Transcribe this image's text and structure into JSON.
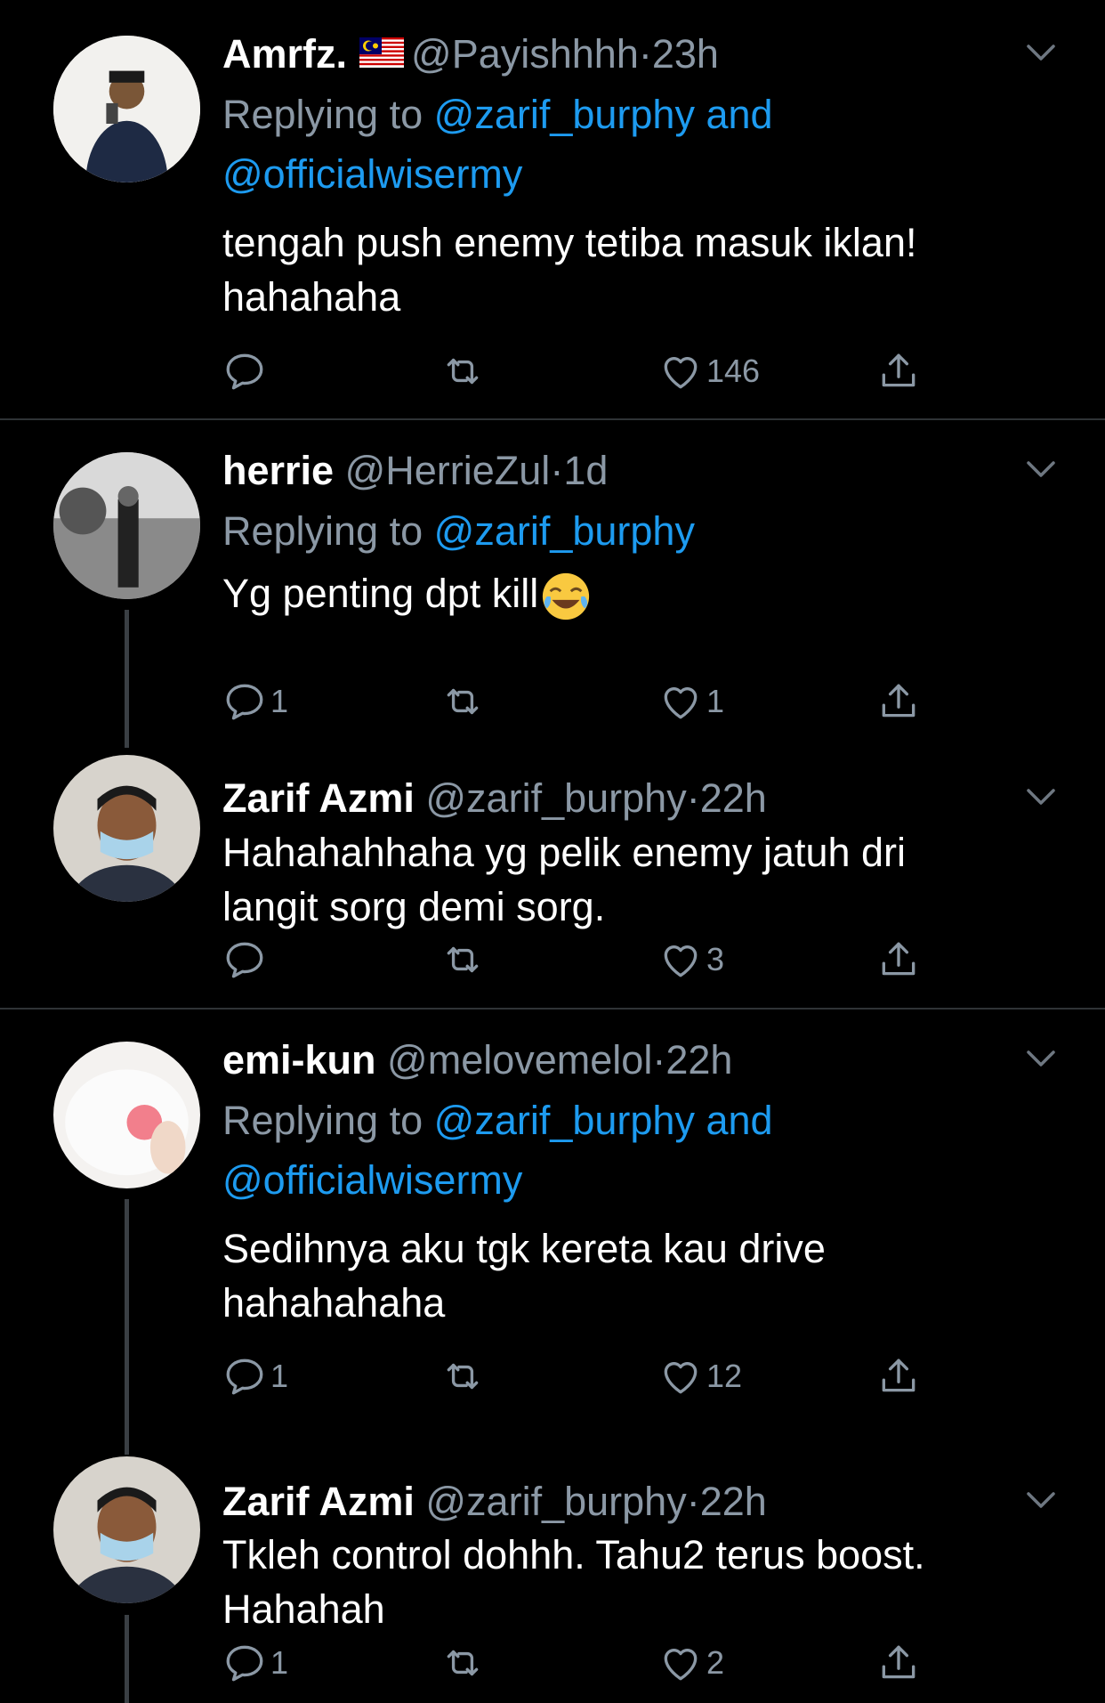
{
  "tweets": [
    {
      "name": "Amrfz.",
      "handle": "@Payishhhh",
      "sep": "·",
      "time": "23h",
      "replying_prefix": "Replying to ",
      "replying_line1": "@zarif_burphy and",
      "replying_line2": "@officialwisermy",
      "text_line1": "tengah push enemy tetiba masuk iklan!",
      "text_line2": "hahahaha",
      "replies": "",
      "likes": "146"
    },
    {
      "name": "herrie",
      "handle": "@HerrieZul",
      "sep": "·",
      "time": "1d",
      "replying_prefix": "Replying to ",
      "replying_line1": "@zarif_burphy",
      "text_line1": "Yg penting dpt kill",
      "emoji": "face-with-tears-of-joy",
      "replies": "1",
      "likes": "1"
    },
    {
      "name": "Zarif Azmi",
      "handle": "@zarif_burphy",
      "sep": "·",
      "time": "22h",
      "text_line1": "Hahahahhaha yg pelik enemy jatuh dri",
      "text_line2": "langit sorg demi sorg.",
      "replies": "",
      "likes": "3"
    },
    {
      "name": "emi-kun",
      "handle": "@melovemelol",
      "sep": "·",
      "time": "22h",
      "replying_prefix": "Replying to ",
      "replying_line1": "@zarif_burphy and",
      "replying_line2": "@officialwisermy",
      "text_line1": "Sedihnya aku tgk kereta kau drive",
      "text_line2": "hahahahaha",
      "replies": "1",
      "likes": "12"
    },
    {
      "name": "Zarif Azmi",
      "handle": "@zarif_burphy",
      "sep": "·",
      "time": "22h",
      "text_line1": "Tkleh control dohhh. Tahu2 terus boost.",
      "text_line2": "Hahahah",
      "replies": "1",
      "likes": "2"
    }
  ],
  "colors": {
    "background": "#000000",
    "secondary_text": "#8b98a5",
    "link": "#1d9bf0",
    "divider": "#2f3336"
  },
  "icons": [
    "reply-icon",
    "retweet-icon",
    "like-icon",
    "share-icon",
    "chevron-down-icon",
    "malaysia-flag-icon"
  ]
}
